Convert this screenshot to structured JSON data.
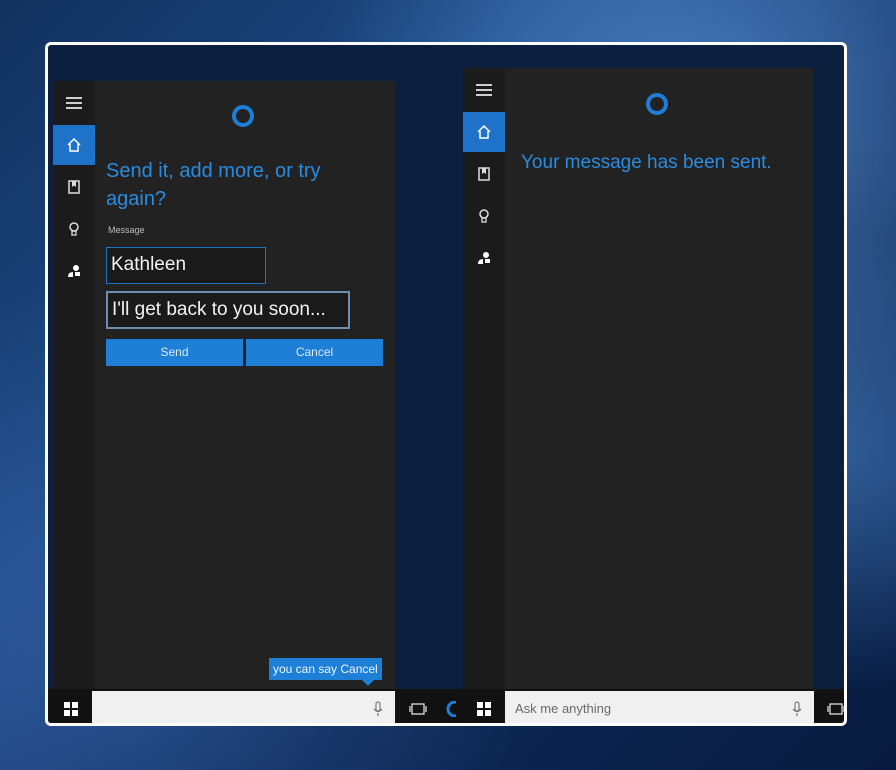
{
  "left_panel": {
    "title": "Send it, add more, or try again?",
    "message_label": "Message",
    "recipient": "Kathleen",
    "message_text": "I'll get back to you soon...",
    "send_label": "Send",
    "cancel_label": "Cancel",
    "tooltip": "you can say Cancel"
  },
  "right_panel": {
    "status": "Your message has been sent."
  },
  "taskbar": {
    "search_placeholder": "Ask me anything"
  },
  "colors": {
    "accent": "#1e7fd6",
    "panel_bg": "#222222",
    "rail_bg": "#1b1b1b"
  },
  "icons": [
    "hamburger-icon",
    "home-icon",
    "notebook-icon",
    "lightbulb-icon",
    "feedback-icon",
    "windows-icon",
    "microphone-icon",
    "task-view-icon",
    "cortana-ring-icon"
  ]
}
